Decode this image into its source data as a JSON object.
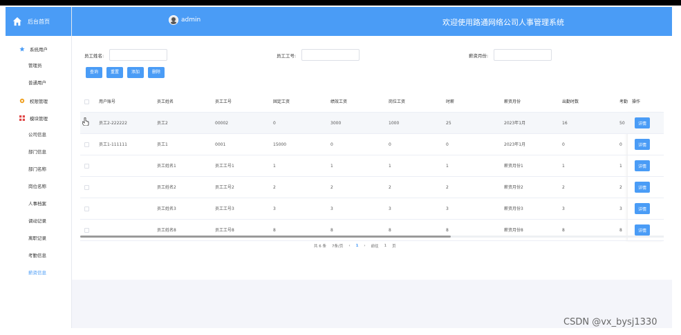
{
  "sidebar": {
    "home_label": "后台首页",
    "groups": [
      {
        "label": "系统用户",
        "items": [
          "管理员",
          "普通用户"
        ]
      },
      {
        "label": "权限管理",
        "items": []
      },
      {
        "label": "模块管理",
        "items": [
          "公司信息",
          "部门信息",
          "部门名称",
          "岗位名称",
          "人事档案",
          "调动记录",
          "离职记录",
          "考勤信息",
          "薪资信息"
        ]
      }
    ]
  },
  "header": {
    "user": "admin",
    "system_name": "欢迎使用路通网络公司人事管理系统"
  },
  "search": {
    "name_label": "员工姓名:",
    "id_label": "员工工号:",
    "month_label": "薪资月份:",
    "name_value": "",
    "id_value": "",
    "month_value": ""
  },
  "buttons": {
    "query": "查询",
    "reset": "重置",
    "add": "添加",
    "delete": "删除"
  },
  "table": {
    "headers": [
      "用户账号",
      "员工姓名",
      "员工工号",
      "固定工资",
      "绩效工资",
      "岗位工资",
      "时薪",
      "薪资月份",
      "出勤时数",
      "考勤",
      "操作"
    ],
    "rows": [
      [
        "员工2-222222",
        "员工2",
        "00002",
        "0",
        "3000",
        "1000",
        "25",
        "2023年1月",
        "16",
        "50"
      ],
      [
        "员工1-111111",
        "员工1",
        "0001",
        "15000",
        "0",
        "0",
        "0",
        "2023年1月",
        "0",
        "0"
      ],
      [
        "",
        "员工姓名1",
        "员工工号1",
        "1",
        "1",
        "1",
        "1",
        "薪资月份1",
        "1",
        "1"
      ],
      [
        "",
        "员工姓名2",
        "员工工号2",
        "2",
        "2",
        "2",
        "2",
        "薪资月份2",
        "2",
        "2"
      ],
      [
        "",
        "员工姓名3",
        "员工工号3",
        "3",
        "3",
        "3",
        "3",
        "薪资月份3",
        "3",
        "3"
      ],
      [
        "",
        "员工姓名8",
        "员工工号8",
        "8",
        "8",
        "8",
        "8",
        "薪资月份8",
        "8",
        "8"
      ]
    ],
    "detail_label": "详情"
  },
  "pagination": {
    "total": "共 6 条",
    "page_size": "7条/页",
    "prev": "‹",
    "current": "1",
    "next": "›",
    "goto": "前往",
    "goto_value": "1",
    "page_unit": "页"
  },
  "watermark": "CSDN @vx_bysj1330",
  "colors": {
    "primary": "#4a9cf6",
    "menu_active": "#4a9cf6"
  }
}
